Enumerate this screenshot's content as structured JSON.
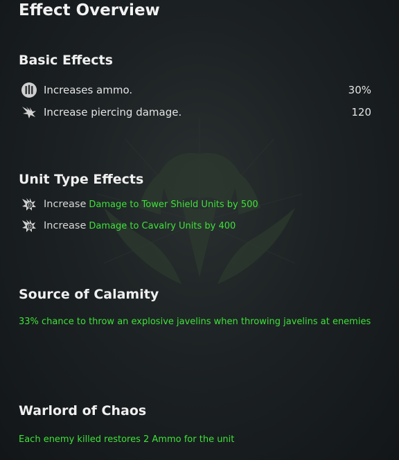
{
  "header": {
    "title": "Effect Overview"
  },
  "basic": {
    "title": "Basic Effects",
    "items": [
      {
        "icon": "ammo-icon",
        "label": "Increases ammo.",
        "value": "30%"
      },
      {
        "icon": "piercing-icon",
        "label": "Increase piercing damage.",
        "value": "120"
      }
    ]
  },
  "unit_type": {
    "title": "Unit Type Effects",
    "items": [
      {
        "icon": "unit-damage-icon",
        "prefix": "Increase",
        "effect": "Damage to Tower Shield Units by 500"
      },
      {
        "icon": "unit-damage-icon",
        "prefix": "Increase",
        "effect": "Damage to Cavalry Units by 400"
      }
    ]
  },
  "calamity": {
    "title": "Source of Calamity",
    "description": "33% chance to throw an explosive javelins when throwing javelins at enemies"
  },
  "warlord": {
    "title": "Warlord of Chaos",
    "description": "Each enemy killed restores 2 Ammo for the unit"
  },
  "colors": {
    "highlight": "#3ee23a",
    "background": "#1c2123"
  }
}
